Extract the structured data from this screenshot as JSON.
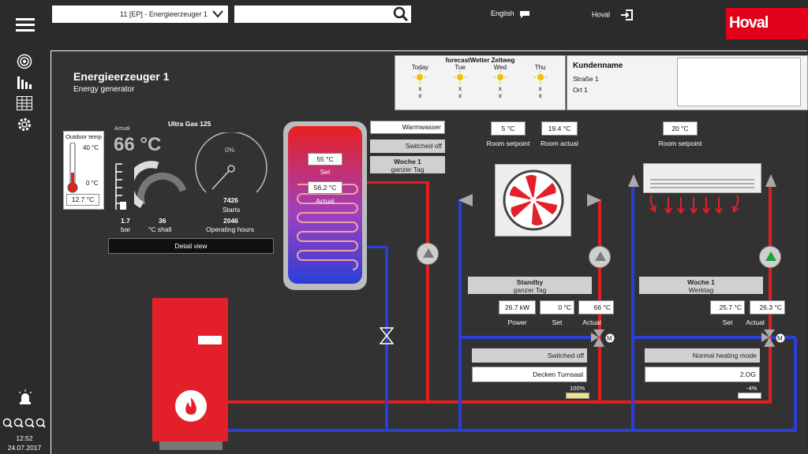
{
  "header": {
    "site_select": "11 [EP] - Energieerzeuger 1",
    "search_value": "",
    "language": "English",
    "user": "Hoval",
    "logo": "Hoval"
  },
  "sidebar": {
    "time": "12:52",
    "date": "24.07.2017",
    "icons": [
      "menu-icon",
      "signal-icon",
      "heating-icon",
      "table-icon",
      "settings-icon",
      "alarm-icon",
      "zoom-icons"
    ]
  },
  "title": {
    "main": "Energieerzeuger 1",
    "sub": "Energy generator"
  },
  "weather": {
    "title": "forecastWetter Zeltweg",
    "days": [
      {
        "day": "Today",
        "x1": "x",
        "x2": "x"
      },
      {
        "day": "Tue",
        "x1": "x",
        "x2": "x"
      },
      {
        "day": "Wed",
        "x1": "x",
        "x2": "x"
      },
      {
        "day": "Thu",
        "x1": "x",
        "x2": "x"
      }
    ]
  },
  "customer": {
    "name": "Kundenname",
    "street": "Straße 1",
    "city": "Ort 1"
  },
  "outdoor": {
    "label": "Outdoor temp",
    "max": "40 °C",
    "min": "0 °C",
    "value": "12.7 °C"
  },
  "boiler": {
    "name": "Ultra Gas 125",
    "actual_label": "Actual",
    "actual_value": "66 °C",
    "pressure": "1.7",
    "pressure_unit": "bar",
    "shall": "36",
    "shall_unit": "°C shall",
    "percent": "0%",
    "starts": "7426",
    "starts_label": "Starts",
    "hours": "2046",
    "hours_label": "Operating hours",
    "detail_button": "Detail view"
  },
  "tank": {
    "set_value": "55 °C",
    "set_label": "Set",
    "actual_value": "56.2 °C",
    "actual_label": "Actual",
    "name": "Warmwasser",
    "status": "Switched off",
    "schedule_title": "Woche 1",
    "schedule_sub": "ganzer Tag"
  },
  "circuit1": {
    "room_setpoint": "5 °C",
    "room_setpoint_label": "Room setpoint",
    "room_actual": "19.4 °C",
    "room_actual_label": "Room actual",
    "schedule_title": "Standby",
    "schedule_sub": "ganzer Tag",
    "power": "26.7 kW",
    "power_label": "Power",
    "set": "0 °C",
    "set_label": "Set",
    "actual": "66 °C",
    "actual_label": "Actual",
    "mode": "Switched off",
    "name": "Decken Turnsaal",
    "valve": "100%"
  },
  "circuit2": {
    "room_setpoint": "20 °C",
    "room_setpoint_label": "Room setpoint",
    "schedule_title": "Woche 1",
    "schedule_sub": "Werktag",
    "set": "25.7 °C",
    "set_label": "Set",
    "actual": "26.3 °C",
    "actual_label": "Actual",
    "mode": "Normal heating mode",
    "name": "2.OG",
    "valve": "-4%"
  },
  "colors": {
    "accent": "#e3001b",
    "pipe_red": "#e02020",
    "pipe_blue": "#2a3fd8"
  }
}
